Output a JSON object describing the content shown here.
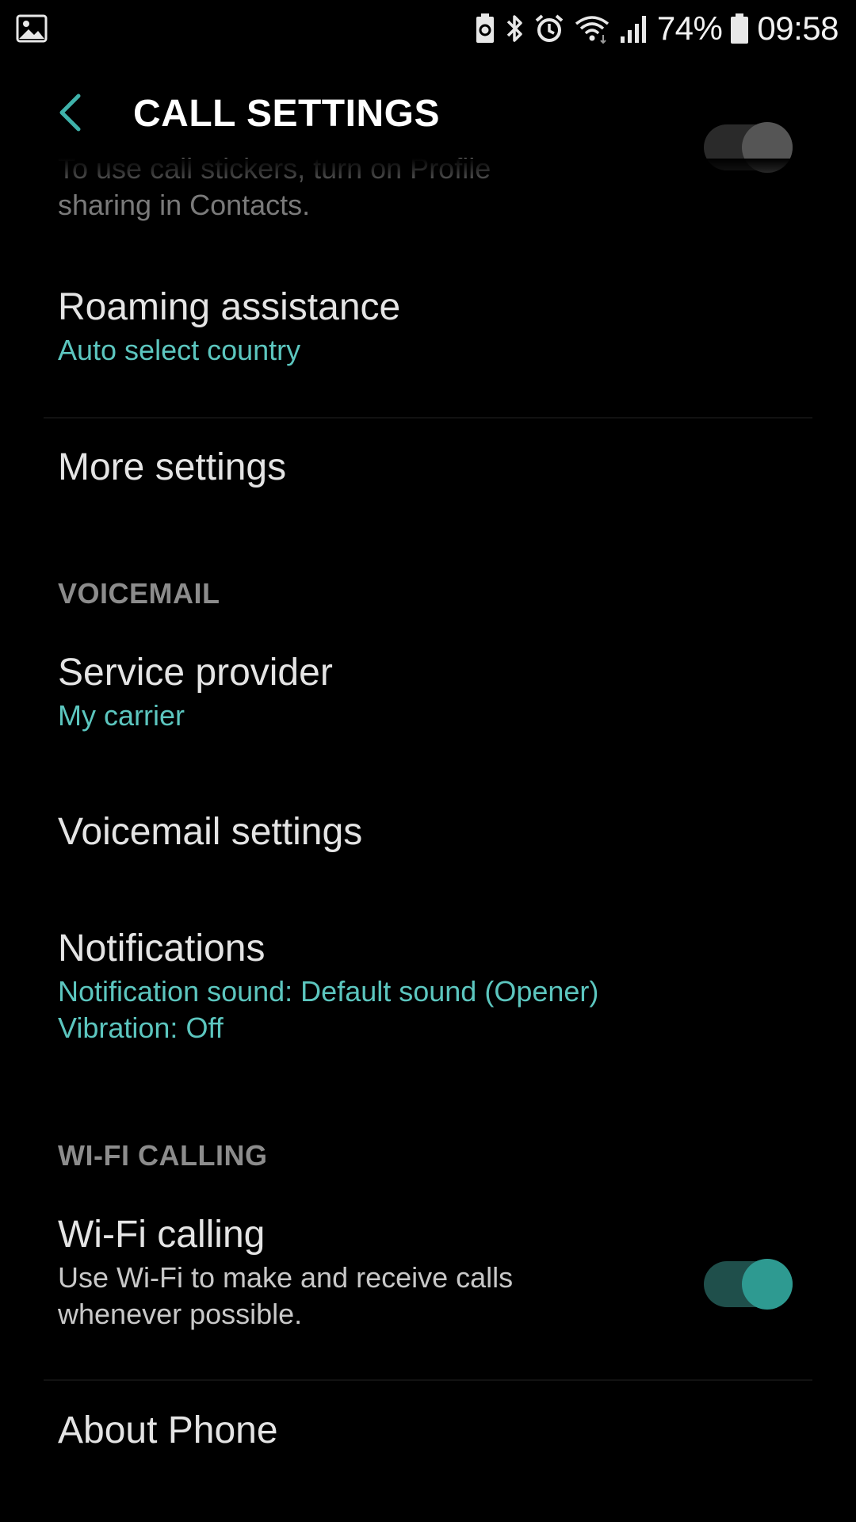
{
  "status_bar": {
    "battery_percent": "74%",
    "time": "09:58"
  },
  "app_bar": {
    "title": "CALL SETTINGS"
  },
  "items": {
    "stickers": {
      "subtitle_line1": "To use call stickers, turn on Profile",
      "subtitle_line2": "sharing in Contacts."
    },
    "roaming": {
      "title": "Roaming assistance",
      "subtitle": "Auto select country"
    },
    "more_settings": {
      "title": "More settings"
    },
    "voicemail_header": "VOICEMAIL",
    "service_provider": {
      "title": "Service provider",
      "subtitle": "My carrier"
    },
    "voicemail_settings": {
      "title": "Voicemail settings"
    },
    "notifications": {
      "title": "Notifications",
      "subtitle_line1": "Notification sound: Default sound (Opener)",
      "subtitle_line2": "Vibration: Off"
    },
    "wifi_header": "WI-FI CALLING",
    "wifi_calling": {
      "title": "Wi-Fi calling",
      "subtitle_line1": "Use Wi-Fi to make and receive calls",
      "subtitle_line2": "whenever possible.",
      "enabled": true
    },
    "about_phone": {
      "title": "About Phone"
    }
  },
  "colors": {
    "accent": "#5cc6bf",
    "toggle_thumb": "#2e9a91",
    "toggle_track": "#1f4f4b",
    "background": "#000000"
  }
}
